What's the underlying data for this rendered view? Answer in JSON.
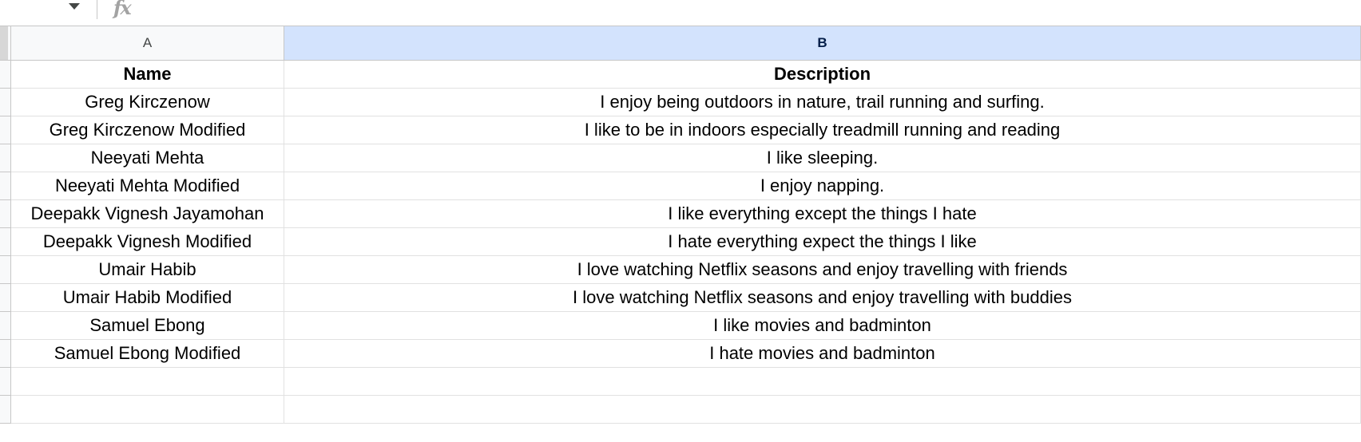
{
  "formula_bar": {
    "icons": {
      "namebox_dropdown": "chevron-down-icon",
      "function": "fx-icon"
    },
    "fx_label": "fx"
  },
  "columns": [
    {
      "letter": "A"
    },
    {
      "letter": "B"
    }
  ],
  "table": {
    "header": [
      "Name",
      "Description"
    ],
    "rows": [
      [
        "Greg Kirczenow",
        "I enjoy being outdoors in nature, trail running and surfing."
      ],
      [
        "Greg Kirczenow Modified",
        "I like to be in indoors especially treadmill running and reading"
      ],
      [
        "Neeyati Mehta",
        "I like sleeping."
      ],
      [
        "Neeyati Mehta Modified",
        "I enjoy napping."
      ],
      [
        "Deepakk Vignesh Jayamohan",
        "I like everything except the things I hate"
      ],
      [
        "Deepakk Vignesh Modified",
        "I hate everything expect the things I like"
      ],
      [
        "Umair Habib",
        "I love watching Netflix seasons and enjoy travelling with friends"
      ],
      [
        "Umair Habib Modified",
        "I love watching Netflix seasons and enjoy travelling with buddies"
      ],
      [
        "Samuel Ebong",
        "I like movies and badminton"
      ],
      [
        "Samuel Ebong Modified",
        "I hate movies and badminton"
      ],
      [
        "",
        ""
      ],
      [
        "",
        ""
      ]
    ]
  },
  "colors": {
    "selected_column_bg": "#d3e3fd",
    "gridline": "#e1e1e1",
    "header_border": "#c7c7c7"
  }
}
